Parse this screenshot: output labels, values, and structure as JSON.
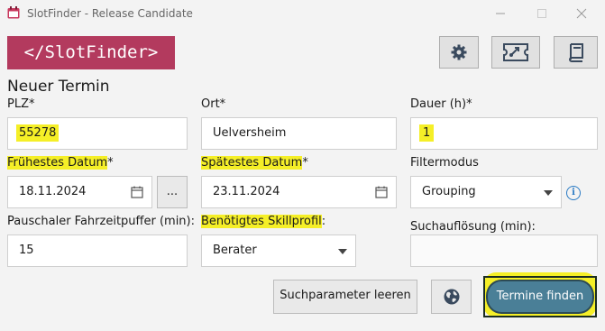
{
  "window": {
    "title": "SlotFinder - Release Candidate"
  },
  "header": {
    "logo_text": "</SlotFinder>"
  },
  "toolbar": {
    "buttons": [
      "gear-icon",
      "ticket-icon",
      "book-icon"
    ]
  },
  "form": {
    "section_title": "Neuer Termin",
    "plz_label": "PLZ*",
    "plz_value": "55278",
    "ort_label": "Ort*",
    "ort_value": "Uelversheim",
    "dauer_label": "Dauer (h)*",
    "dauer_value": "1",
    "fruehestes_label": "Frühestes Datum",
    "fruehestes_star": "*",
    "fruehestes_value": "18.11.2024",
    "ellipsis_label": "...",
    "spaetestes_label": "Spätestes Datum",
    "spaetestes_star": "*",
    "spaetestes_value": "23.11.2024",
    "filtermodus_label": "Filtermodus",
    "filtermodus_value": "Grouping",
    "puffer_label": "Pauschaler Fahrzeitpuffer (min):",
    "puffer_value": "15",
    "skill_label": "Benötigtes Skillprofil",
    "skill_colon": ":",
    "skill_value": "Berater",
    "suchaufloesung_label": "Suchauflösung (min):",
    "suchaufloesung_value": ""
  },
  "actions": {
    "clear_label": "Suchparameter leeren",
    "find_label": "Termine finden"
  },
  "colors": {
    "logo_bg": "#b33a5e",
    "highlight": "#f5ef27",
    "primary_button": "#4a7f97"
  }
}
